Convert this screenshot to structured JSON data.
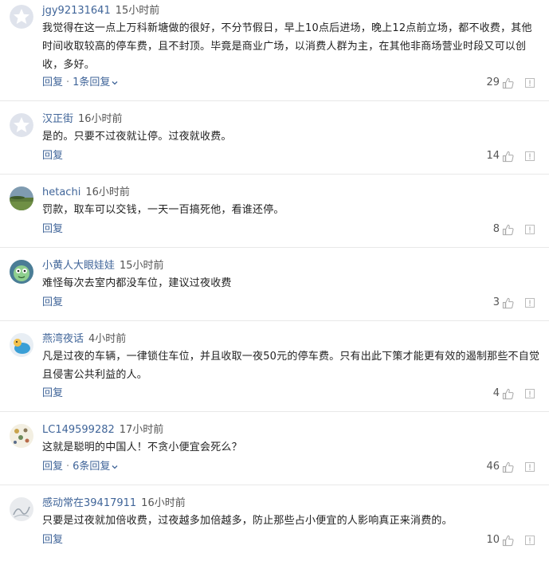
{
  "comments": [
    {
      "user": "jgy92131641",
      "time": "15小时前",
      "text": "我觉得在这一点上万科新塘做的很好，不分节假日，早上10点后进场，晚上12点前立场，都不收费，其他时间收取较高的停车费，且不封顶。毕竟是商业广场，以消费人群为主，在其他非商场营业时段又可以创收，多好。",
      "reply": "回复",
      "sep": "·",
      "replies": "1条回复",
      "likes": "29",
      "avatar": "default-star"
    },
    {
      "user": "汉正街",
      "time": "16小时前",
      "text": "是的。只要不过夜就让停。过夜就收费。",
      "reply": "回复",
      "likes": "14",
      "avatar": "default-star"
    },
    {
      "user": "hetachi",
      "time": "16小时前",
      "text": "罚款，取车可以交钱，一天一百搞死他，看谁还停。",
      "reply": "回复",
      "likes": "8",
      "avatar": "landscape"
    },
    {
      "user": "小黄人大眼娃娃",
      "time": "15小时前",
      "text": "难怪每次去室内都没车位，建议过夜收费",
      "reply": "回复",
      "likes": "3",
      "avatar": "cartoon"
    },
    {
      "user": "燕湾夜话",
      "time": "4小时前",
      "text": "凡是过夜的车辆，一律锁住车位，并且收取一夜50元的停车费。只有出此下策才能更有效的遏制那些不自觉且侵害公共利益的人。",
      "reply": "回复",
      "likes": "4",
      "avatar": "bird"
    },
    {
      "user": "LC149599282",
      "time": "17小时前",
      "text": "这就是聪明的中国人！不贪小便宜会死么？",
      "reply": "回复",
      "sep": "·",
      "replies": "6条回复",
      "likes": "46",
      "avatar": "painting"
    },
    {
      "user": "感动常在39417911",
      "time": "16小时前",
      "text": "只要是过夜就加倍收费，过夜越多加倍越多，防止那些占小便宜的人影响真正来消费的。",
      "reply": "回复",
      "likes": "10",
      "avatar": "sketch"
    }
  ],
  "colors": {
    "link": "#406599",
    "text": "#222222",
    "meta": "#555555",
    "divider": "#e8e8e8"
  },
  "icons": {
    "like": "thumbs-up-icon",
    "report": "report-icon",
    "expand": "chevron-down-icon"
  }
}
